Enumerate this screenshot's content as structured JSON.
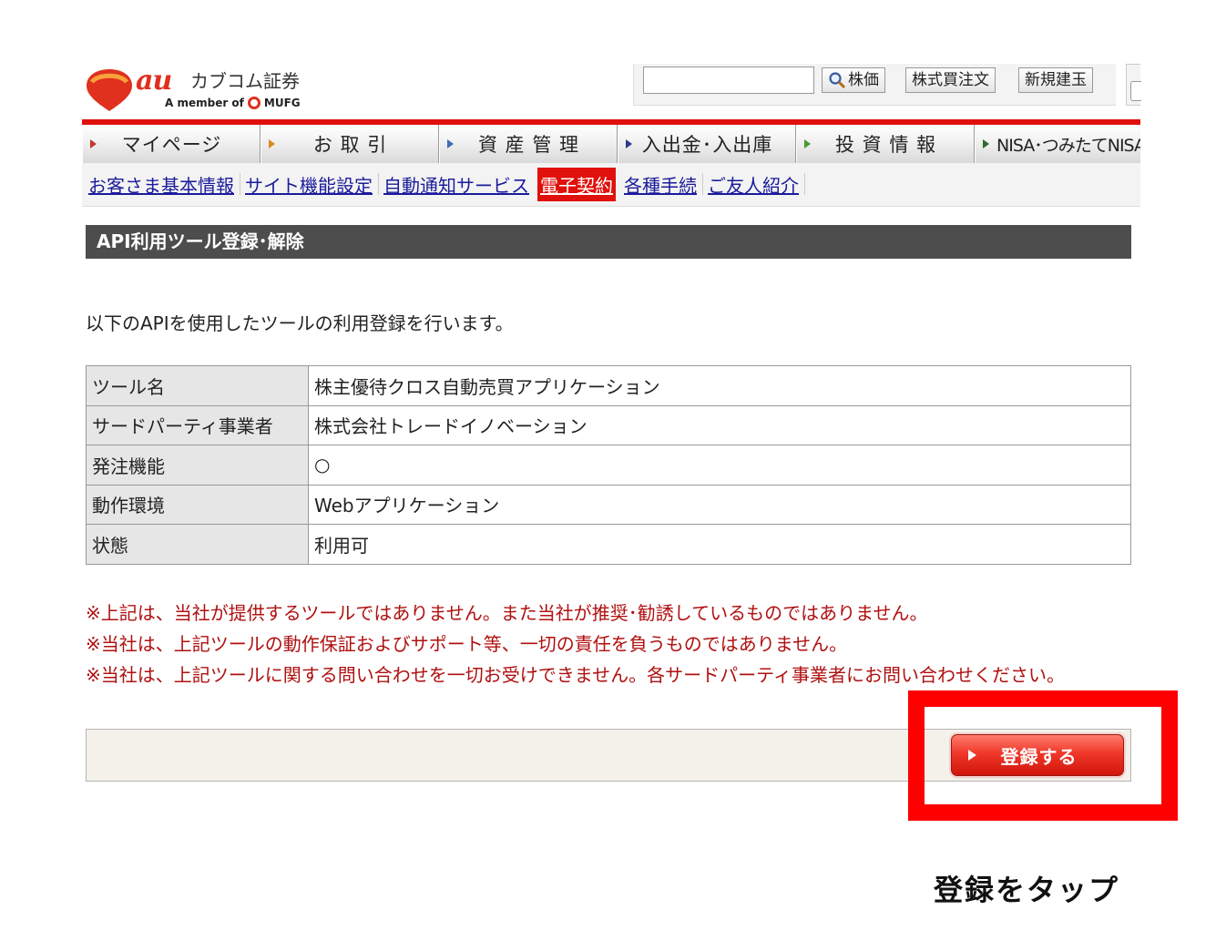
{
  "header": {
    "brand_au": "au",
    "brand_name": "カブコム証券",
    "brand_member": "A member of",
    "brand_group": "MUFG",
    "search": {
      "value": "",
      "placeholder": ""
    },
    "buttons": [
      "株価",
      "株式買注文",
      "新規建玉"
    ]
  },
  "main_nav": [
    "マイページ",
    "お 取 引",
    "資 産 管 理",
    "入出金･入出庫",
    "投 資 情 報",
    "NISA･つみたてNISA"
  ],
  "main_nav_tri_colors": [
    "#c0392b",
    "#d98b1c",
    "#3a6fb0",
    "#2d3a8c",
    "#4a9b2f",
    "#2d6a2d"
  ],
  "sub_nav": [
    {
      "label": "お客さま基本情報",
      "active": false
    },
    {
      "label": "サイト機能設定",
      "active": false
    },
    {
      "label": "自動通知サービス",
      "active": false
    },
    {
      "label": "電子契約",
      "active": true
    },
    {
      "label": "各種手続",
      "active": false
    },
    {
      "label": "ご友人紹介",
      "active": false
    }
  ],
  "page_title": "API利用ツール登録･解除",
  "intro": "以下のAPIを使用したツールの利用登録を行います。",
  "table_rows": [
    {
      "label": "ツール名",
      "value": "株主優待クロス自動売買アプリケーション"
    },
    {
      "label": "サードパーティ事業者",
      "value": "株式会社トレードイノベーション"
    },
    {
      "label": "発注機能",
      "value": "○"
    },
    {
      "label": "動作環境",
      "value": "Webアプリケーション"
    },
    {
      "label": "状態",
      "value": "利用可"
    }
  ],
  "notes": [
    "※上記は、当社が提供するツールではありません。また当社が推奨･勧誘しているものではありません。",
    "※当社は、上記ツールの動作保証およびサポート等、一切の責任を負うものではありません。",
    "※当社は、上記ツールに関する問い合わせを一切お受けできません。各サードパーティ事業者にお問い合わせください。"
  ],
  "register_button": "登録する",
  "caption": "登録をタップ",
  "colors": {
    "accent_red": "#e0100c",
    "title_bar": "#4d4d4d",
    "note_text": "#b01010",
    "link": "#1b1b9c"
  }
}
